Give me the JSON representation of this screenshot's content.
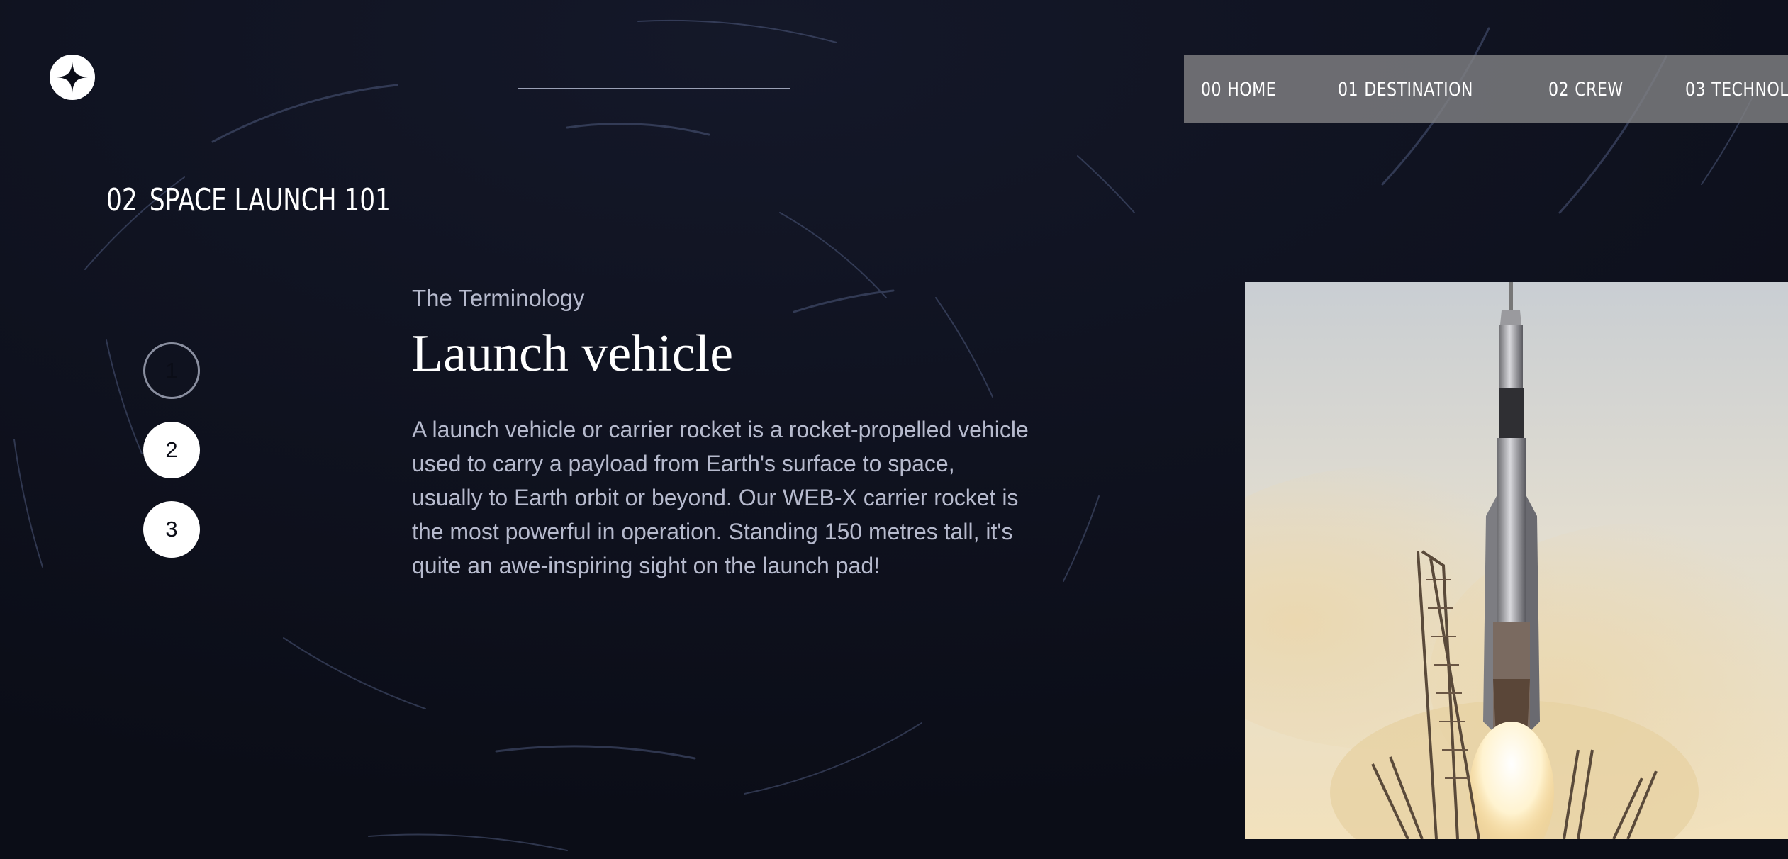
{
  "header": {
    "logo_icon": "four-point-star-icon",
    "nav": [
      {
        "num": "00",
        "label": "HOME"
      },
      {
        "num": "01",
        "label": "DESTINATION"
      },
      {
        "num": "02",
        "label": "CREW"
      },
      {
        "num": "03",
        "label": "TECHNOLOGY"
      }
    ]
  },
  "page": {
    "num": "02",
    "title": "SPACE LAUNCH 101"
  },
  "steps": [
    {
      "label": "1",
      "state": "active"
    },
    {
      "label": "2",
      "state": "inactive"
    },
    {
      "label": "3",
      "state": "inactive"
    }
  ],
  "content": {
    "subheading": "The Terminology",
    "title": "Launch vehicle",
    "body": "A launch vehicle or carrier rocket is a rocket-propelled vehicle used to carry a payload from Earth's surface to space, usually to Earth orbit or beyond. Our WEB-X carrier rocket is the most powerful in operation. Standing 150 metres tall, it's quite an awe-inspiring sight on the launch pad!"
  },
  "colors": {
    "background": "#0b0d17",
    "text_muted": "#b6bacd",
    "nav_background": "#808083"
  }
}
